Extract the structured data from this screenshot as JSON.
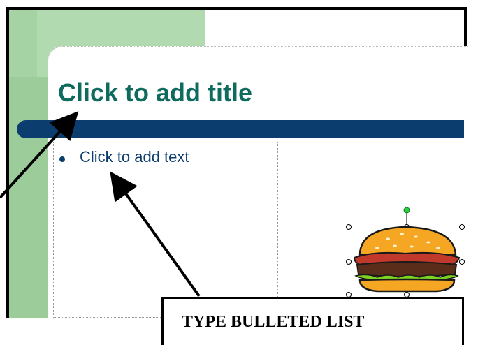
{
  "slide": {
    "title_placeholder": "Click to add title",
    "body_placeholder": "Click to add text"
  },
  "callout": {
    "label": "TYPE BULLETED LIST"
  },
  "clipart": {
    "icon": "hamburger-icon",
    "selected": true
  },
  "colors": {
    "title": "#0f6b5d",
    "accent_bar": "#0b3d6e",
    "sidebar_green": "#9ccc9a"
  }
}
